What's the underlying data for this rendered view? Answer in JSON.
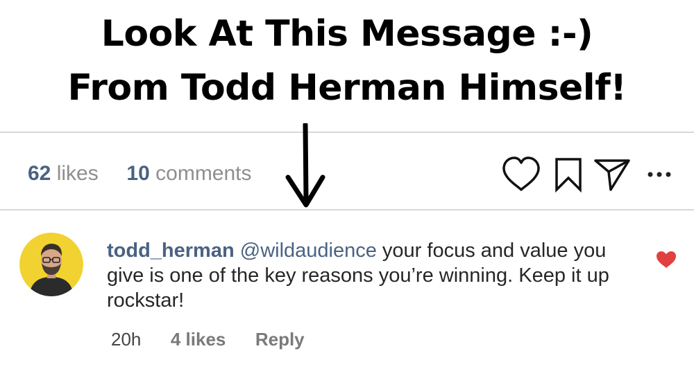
{
  "headline": {
    "line1": "Look At This Message :-)",
    "line2": "From Todd Herman Himself!"
  },
  "post_stats": {
    "likes_count": "62",
    "likes_label": "likes",
    "comments_count": "10",
    "comments_label": "comments"
  },
  "actions": {
    "like_icon": "heart-outline-icon",
    "save_icon": "bookmark-icon",
    "share_icon": "send-icon",
    "more_icon": "ellipsis-icon"
  },
  "comment": {
    "username": "todd_herman",
    "mention": "@wildaudience",
    "text": " your focus and value you give is one of the key reasons you’re winning. Keep it up rockstar!",
    "liked": true,
    "like_color": "#e0413e",
    "time": "20h",
    "likes": "4 likes",
    "reply_label": "Reply"
  },
  "colors": {
    "link": "#4a6282",
    "muted": "#8e8e8e",
    "avatar_bg": "#f2d230"
  }
}
